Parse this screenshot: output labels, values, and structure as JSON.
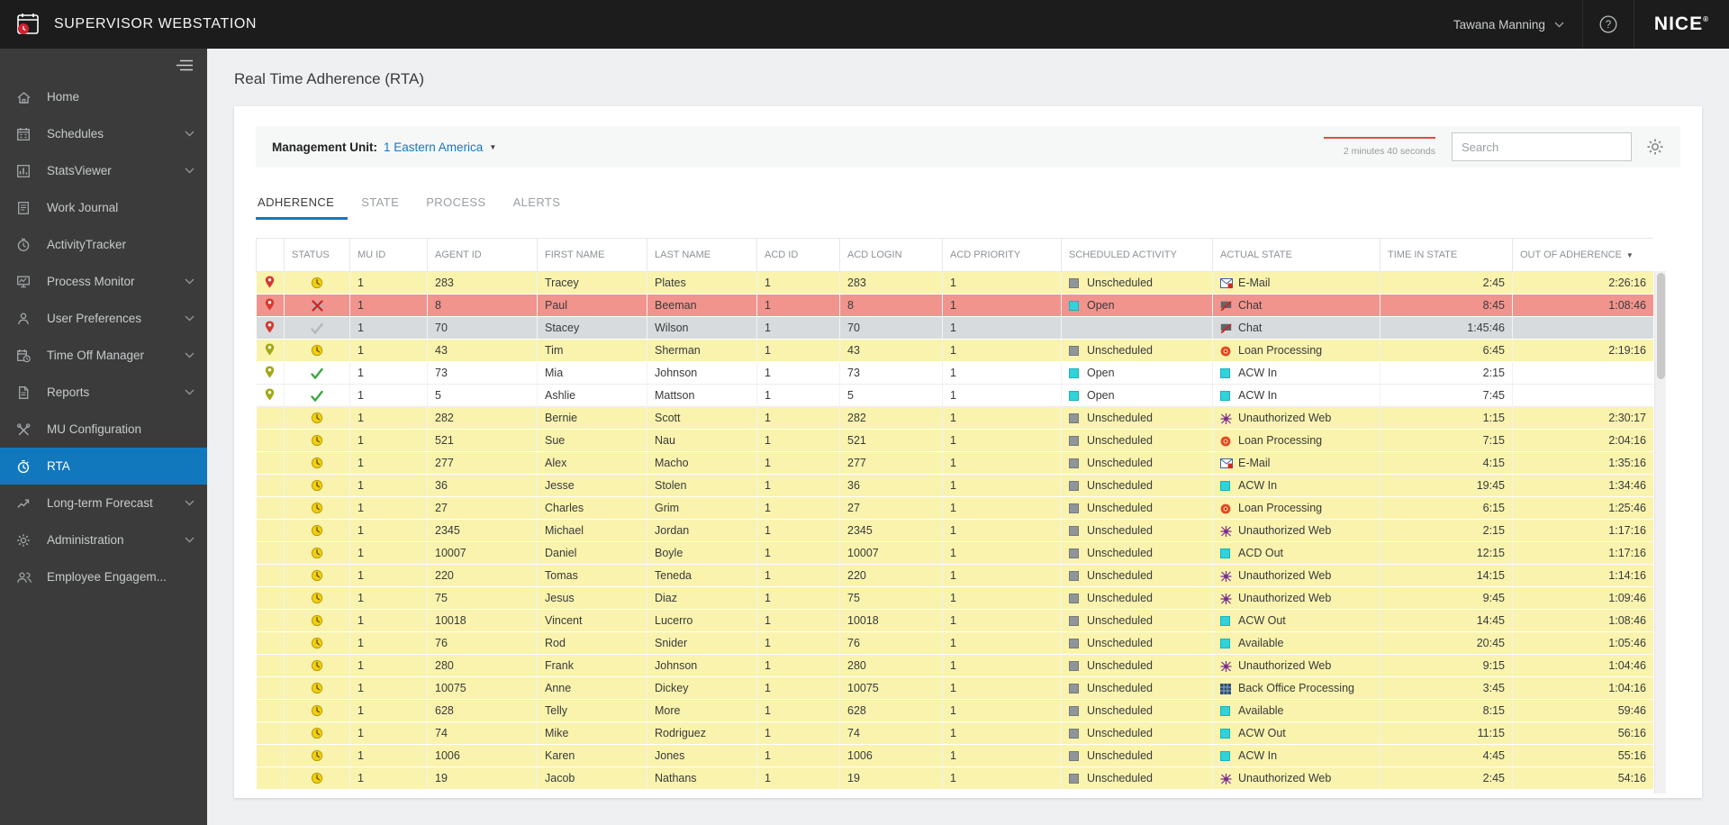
{
  "topbar": {
    "title": "SUPERVISOR WEBSTATION",
    "user": "Tawana Manning",
    "brand": "NICE",
    "registered_mark": "®"
  },
  "page": {
    "title": "Real Time Adherence (RTA)"
  },
  "sidebar": {
    "items": [
      {
        "label": "Home",
        "icon": "home-icon",
        "expandable": false,
        "active": false
      },
      {
        "label": "Schedules",
        "icon": "calendar-icon",
        "expandable": true,
        "active": false
      },
      {
        "label": "StatsViewer",
        "icon": "chart-icon",
        "expandable": true,
        "active": false
      },
      {
        "label": "Work Journal",
        "icon": "journal-icon",
        "expandable": false,
        "active": false
      },
      {
        "label": "ActivityTracker",
        "icon": "tracker-icon",
        "expandable": false,
        "active": false
      },
      {
        "label": "Process Monitor",
        "icon": "monitor-icon",
        "expandable": true,
        "active": false
      },
      {
        "label": "User Preferences",
        "icon": "user-icon",
        "expandable": true,
        "active": false
      },
      {
        "label": "Time Off Manager",
        "icon": "timeoff-icon",
        "expandable": true,
        "active": false
      },
      {
        "label": "Reports",
        "icon": "reports-icon",
        "expandable": true,
        "active": false
      },
      {
        "label": "MU Configuration",
        "icon": "tools-icon",
        "expandable": false,
        "active": false
      },
      {
        "label": "RTA",
        "icon": "rta-icon",
        "expandable": false,
        "active": true
      },
      {
        "label": "Long-term Forecast",
        "icon": "forecast-icon",
        "expandable": true,
        "active": false
      },
      {
        "label": "Administration",
        "icon": "gear-icon",
        "expandable": true,
        "active": false
      },
      {
        "label": "Employee Engagem...",
        "icon": "people-icon",
        "expandable": false,
        "active": false
      }
    ]
  },
  "toolbar": {
    "management_unit_label": "Management Unit:",
    "management_unit_value": "1 Eastern America",
    "refresh_countdown": "2 minutes 40 seconds",
    "search_placeholder": "Search"
  },
  "tabs": [
    {
      "label": "ADHERENCE",
      "active": true
    },
    {
      "label": "STATE",
      "active": false
    },
    {
      "label": "PROCESS",
      "active": false
    },
    {
      "label": "ALERTS",
      "active": false
    }
  ],
  "table": {
    "columns": [
      {
        "label": ""
      },
      {
        "label": "STATUS"
      },
      {
        "label": "MU ID"
      },
      {
        "label": "AGENT ID"
      },
      {
        "label": "FIRST NAME"
      },
      {
        "label": "LAST NAME"
      },
      {
        "label": "ACD ID"
      },
      {
        "label": "ACD LOGIN"
      },
      {
        "label": "ACD PRIORITY"
      },
      {
        "label": "SCHEDULED ACTIVITY"
      },
      {
        "label": "ACTUAL STATE"
      },
      {
        "label": "TIME IN STATE"
      },
      {
        "label": "OUT OF ADHERENCE",
        "sorted": "desc"
      }
    ],
    "rows": [
      {
        "pin": "red",
        "status": "status-late-icon",
        "mu_id": "1",
        "agent_id": "283",
        "first_name": "Tracey",
        "last_name": "Plates",
        "acd_id": "1",
        "acd_login": "283",
        "acd_priority": "1",
        "scheduled": {
          "label": "Unscheduled",
          "icon": "state-square-gray"
        },
        "actual": {
          "label": "E-Mail",
          "icon": "email-icon"
        },
        "time_in_state": "2:45",
        "out_of_adherence": "2:26:16",
        "highlight": "yellow"
      },
      {
        "pin": "red",
        "status": "status-missed-icon",
        "mu_id": "1",
        "agent_id": "8",
        "first_name": "Paul",
        "last_name": "Beeman",
        "acd_id": "1",
        "acd_login": "8",
        "acd_priority": "1",
        "scheduled": {
          "label": "Open",
          "icon": "state-square-cyan"
        },
        "actual": {
          "label": "Chat",
          "icon": "chat-icon"
        },
        "time_in_state": "8:45",
        "out_of_adherence": "1:08:46",
        "highlight": "red"
      },
      {
        "pin": "red",
        "status": "status-neutral-icon",
        "mu_id": "1",
        "agent_id": "70",
        "first_name": "Stacey",
        "last_name": "Wilson",
        "acd_id": "1",
        "acd_login": "70",
        "acd_priority": "1",
        "scheduled": {
          "label": "",
          "icon": ""
        },
        "actual": {
          "label": "Chat",
          "icon": "chat-icon"
        },
        "time_in_state": "1:45:46",
        "out_of_adherence": "",
        "highlight": "selected"
      },
      {
        "pin": "olive",
        "status": "status-late-icon",
        "mu_id": "1",
        "agent_id": "43",
        "first_name": "Tim",
        "last_name": "Sherman",
        "acd_id": "1",
        "acd_login": "43",
        "acd_priority": "1",
        "scheduled": {
          "label": "Unscheduled",
          "icon": "state-square-gray"
        },
        "actual": {
          "label": "Loan Processing",
          "icon": "loan-processing-icon"
        },
        "time_in_state": "6:45",
        "out_of_adherence": "2:19:16",
        "highlight": "yellow"
      },
      {
        "pin": "olive",
        "status": "status-ok-icon",
        "mu_id": "1",
        "agent_id": "73",
        "first_name": "Mia",
        "last_name": "Johnson",
        "acd_id": "1",
        "acd_login": "73",
        "acd_priority": "1",
        "scheduled": {
          "label": "Open",
          "icon": "state-square-cyan"
        },
        "actual": {
          "label": "ACW In",
          "icon": "state-square-cyan"
        },
        "time_in_state": "2:15",
        "out_of_adherence": "",
        "highlight": "white"
      },
      {
        "pin": "olive",
        "status": "status-ok-icon",
        "mu_id": "1",
        "agent_id": "5",
        "first_name": "Ashlie",
        "last_name": "Mattson",
        "acd_id": "1",
        "acd_login": "5",
        "acd_priority": "1",
        "scheduled": {
          "label": "Open",
          "icon": "state-square-cyan"
        },
        "actual": {
          "label": "ACW In",
          "icon": "state-square-cyan"
        },
        "time_in_state": "7:45",
        "out_of_adherence": "",
        "highlight": "white"
      },
      {
        "pin": "",
        "status": "status-late-icon",
        "mu_id": "1",
        "agent_id": "282",
        "first_name": "Bernie",
        "last_name": "Scott",
        "acd_id": "1",
        "acd_login": "282",
        "acd_priority": "1",
        "scheduled": {
          "label": "Unscheduled",
          "icon": "state-square-gray"
        },
        "actual": {
          "label": "Unauthorized Web",
          "icon": "unauthorized-web-icon"
        },
        "time_in_state": "1:15",
        "out_of_adherence": "2:30:17",
        "highlight": "yellow"
      },
      {
        "pin": "",
        "status": "status-late-icon",
        "mu_id": "1",
        "agent_id": "521",
        "first_name": "Sue",
        "last_name": "Nau",
        "acd_id": "1",
        "acd_login": "521",
        "acd_priority": "1",
        "scheduled": {
          "label": "Unscheduled",
          "icon": "state-square-gray"
        },
        "actual": {
          "label": "Loan Processing",
          "icon": "loan-processing-icon"
        },
        "time_in_state": "7:15",
        "out_of_adherence": "2:04:16",
        "highlight": "yellow"
      },
      {
        "pin": "",
        "status": "status-late-icon",
        "mu_id": "1",
        "agent_id": "277",
        "first_name": "Alex",
        "last_name": "Macho",
        "acd_id": "1",
        "acd_login": "277",
        "acd_priority": "1",
        "scheduled": {
          "label": "Unscheduled",
          "icon": "state-square-gray"
        },
        "actual": {
          "label": "E-Mail",
          "icon": "email-icon"
        },
        "time_in_state": "4:15",
        "out_of_adherence": "1:35:16",
        "highlight": "yellow"
      },
      {
        "pin": "",
        "status": "status-late-icon",
        "mu_id": "1",
        "agent_id": "36",
        "first_name": "Jesse",
        "last_name": "Stolen",
        "acd_id": "1",
        "acd_login": "36",
        "acd_priority": "1",
        "scheduled": {
          "label": "Unscheduled",
          "icon": "state-square-gray"
        },
        "actual": {
          "label": "ACW In",
          "icon": "state-square-cyan"
        },
        "time_in_state": "19:45",
        "out_of_adherence": "1:34:46",
        "highlight": "yellow"
      },
      {
        "pin": "",
        "status": "status-late-icon",
        "mu_id": "1",
        "agent_id": "27",
        "first_name": "Charles",
        "last_name": "Grim",
        "acd_id": "1",
        "acd_login": "27",
        "acd_priority": "1",
        "scheduled": {
          "label": "Unscheduled",
          "icon": "state-square-gray"
        },
        "actual": {
          "label": "Loan Processing",
          "icon": "loan-processing-icon"
        },
        "time_in_state": "6:15",
        "out_of_adherence": "1:25:46",
        "highlight": "yellow"
      },
      {
        "pin": "",
        "status": "status-late-icon",
        "mu_id": "1",
        "agent_id": "2345",
        "first_name": "Michael",
        "last_name": "Jordan",
        "acd_id": "1",
        "acd_login": "2345",
        "acd_priority": "1",
        "scheduled": {
          "label": "Unscheduled",
          "icon": "state-square-gray"
        },
        "actual": {
          "label": "Unauthorized Web",
          "icon": "unauthorized-web-icon"
        },
        "time_in_state": "2:15",
        "out_of_adherence": "1:17:16",
        "highlight": "yellow"
      },
      {
        "pin": "",
        "status": "status-late-icon",
        "mu_id": "1",
        "agent_id": "10007",
        "first_name": "Daniel",
        "last_name": "Boyle",
        "acd_id": "1",
        "acd_login": "10007",
        "acd_priority": "1",
        "scheduled": {
          "label": "Unscheduled",
          "icon": "state-square-gray"
        },
        "actual": {
          "label": "ACD Out",
          "icon": "state-square-cyan"
        },
        "time_in_state": "12:15",
        "out_of_adherence": "1:17:16",
        "highlight": "yellow"
      },
      {
        "pin": "",
        "status": "status-late-icon",
        "mu_id": "1",
        "agent_id": "220",
        "first_name": "Tomas",
        "last_name": "Teneda",
        "acd_id": "1",
        "acd_login": "220",
        "acd_priority": "1",
        "scheduled": {
          "label": "Unscheduled",
          "icon": "state-square-gray"
        },
        "actual": {
          "label": "Unauthorized Web",
          "icon": "unauthorized-web-icon"
        },
        "time_in_state": "14:15",
        "out_of_adherence": "1:14:16",
        "highlight": "yellow"
      },
      {
        "pin": "",
        "status": "status-late-icon",
        "mu_id": "1",
        "agent_id": "75",
        "first_name": "Jesus",
        "last_name": "Diaz",
        "acd_id": "1",
        "acd_login": "75",
        "acd_priority": "1",
        "scheduled": {
          "label": "Unscheduled",
          "icon": "state-square-gray"
        },
        "actual": {
          "label": "Unauthorized Web",
          "icon": "unauthorized-web-icon"
        },
        "time_in_state": "9:45",
        "out_of_adherence": "1:09:46",
        "highlight": "yellow"
      },
      {
        "pin": "",
        "status": "status-late-icon",
        "mu_id": "1",
        "agent_id": "10018",
        "first_name": "Vincent",
        "last_name": "Lucerro",
        "acd_id": "1",
        "acd_login": "10018",
        "acd_priority": "1",
        "scheduled": {
          "label": "Unscheduled",
          "icon": "state-square-gray"
        },
        "actual": {
          "label": "ACW Out",
          "icon": "state-square-cyan"
        },
        "time_in_state": "14:45",
        "out_of_adherence": "1:08:46",
        "highlight": "yellow"
      },
      {
        "pin": "",
        "status": "status-late-icon",
        "mu_id": "1",
        "agent_id": "76",
        "first_name": "Rod",
        "last_name": "Snider",
        "acd_id": "1",
        "acd_login": "76",
        "acd_priority": "1",
        "scheduled": {
          "label": "Unscheduled",
          "icon": "state-square-gray"
        },
        "actual": {
          "label": "Available",
          "icon": "state-square-cyan"
        },
        "time_in_state": "20:45",
        "out_of_adherence": "1:05:46",
        "highlight": "yellow"
      },
      {
        "pin": "",
        "status": "status-late-icon",
        "mu_id": "1",
        "agent_id": "280",
        "first_name": "Frank",
        "last_name": "Johnson",
        "acd_id": "1",
        "acd_login": "280",
        "acd_priority": "1",
        "scheduled": {
          "label": "Unscheduled",
          "icon": "state-square-gray"
        },
        "actual": {
          "label": "Unauthorized Web",
          "icon": "unauthorized-web-icon"
        },
        "time_in_state": "9:15",
        "out_of_adherence": "1:04:46",
        "highlight": "yellow"
      },
      {
        "pin": "",
        "status": "status-late-icon",
        "mu_id": "1",
        "agent_id": "10075",
        "first_name": "Anne",
        "last_name": "Dickey",
        "acd_id": "1",
        "acd_login": "10075",
        "acd_priority": "1",
        "scheduled": {
          "label": "Unscheduled",
          "icon": "state-square-gray"
        },
        "actual": {
          "label": "Back Office Processing",
          "icon": "back-office-icon"
        },
        "time_in_state": "3:45",
        "out_of_adherence": "1:04:16",
        "highlight": "yellow"
      },
      {
        "pin": "",
        "status": "status-late-icon",
        "mu_id": "1",
        "agent_id": "628",
        "first_name": "Telly",
        "last_name": "More",
        "acd_id": "1",
        "acd_login": "628",
        "acd_priority": "1",
        "scheduled": {
          "label": "Unscheduled",
          "icon": "state-square-gray"
        },
        "actual": {
          "label": "Available",
          "icon": "state-square-cyan"
        },
        "time_in_state": "8:15",
        "out_of_adherence": "59:46",
        "highlight": "yellow"
      },
      {
        "pin": "",
        "status": "status-late-icon",
        "mu_id": "1",
        "agent_id": "74",
        "first_name": "Mike",
        "last_name": "Rodriguez",
        "acd_id": "1",
        "acd_login": "74",
        "acd_priority": "1",
        "scheduled": {
          "label": "Unscheduled",
          "icon": "state-square-gray"
        },
        "actual": {
          "label": "ACW Out",
          "icon": "state-square-cyan"
        },
        "time_in_state": "11:15",
        "out_of_adherence": "56:16",
        "highlight": "yellow"
      },
      {
        "pin": "",
        "status": "status-late-icon",
        "mu_id": "1",
        "agent_id": "1006",
        "first_name": "Karen",
        "last_name": "Jones",
        "acd_id": "1",
        "acd_login": "1006",
        "acd_priority": "1",
        "scheduled": {
          "label": "Unscheduled",
          "icon": "state-square-gray"
        },
        "actual": {
          "label": "ACW In",
          "icon": "state-square-cyan"
        },
        "time_in_state": "4:45",
        "out_of_adherence": "55:16",
        "highlight": "yellow"
      },
      {
        "pin": "",
        "status": "status-late-icon",
        "mu_id": "1",
        "agent_id": "19",
        "first_name": "Jacob",
        "last_name": "Nathans",
        "acd_id": "1",
        "acd_login": "19",
        "acd_priority": "1",
        "scheduled": {
          "label": "Unscheduled",
          "icon": "state-square-gray"
        },
        "actual": {
          "label": "Unauthorized Web",
          "icon": "unauthorized-web-icon"
        },
        "time_in_state": "2:45",
        "out_of_adherence": "54:16",
        "highlight": "yellow"
      }
    ]
  },
  "colors": {
    "accent_blue": "#1278be",
    "row_yellow": "#f9f3ae",
    "row_red": "#f1948e",
    "row_selected": "#d8dbdd",
    "countdown_red": "#e04b3f",
    "state_cyan": "#31d2d9",
    "state_gray": "#8f9598"
  }
}
